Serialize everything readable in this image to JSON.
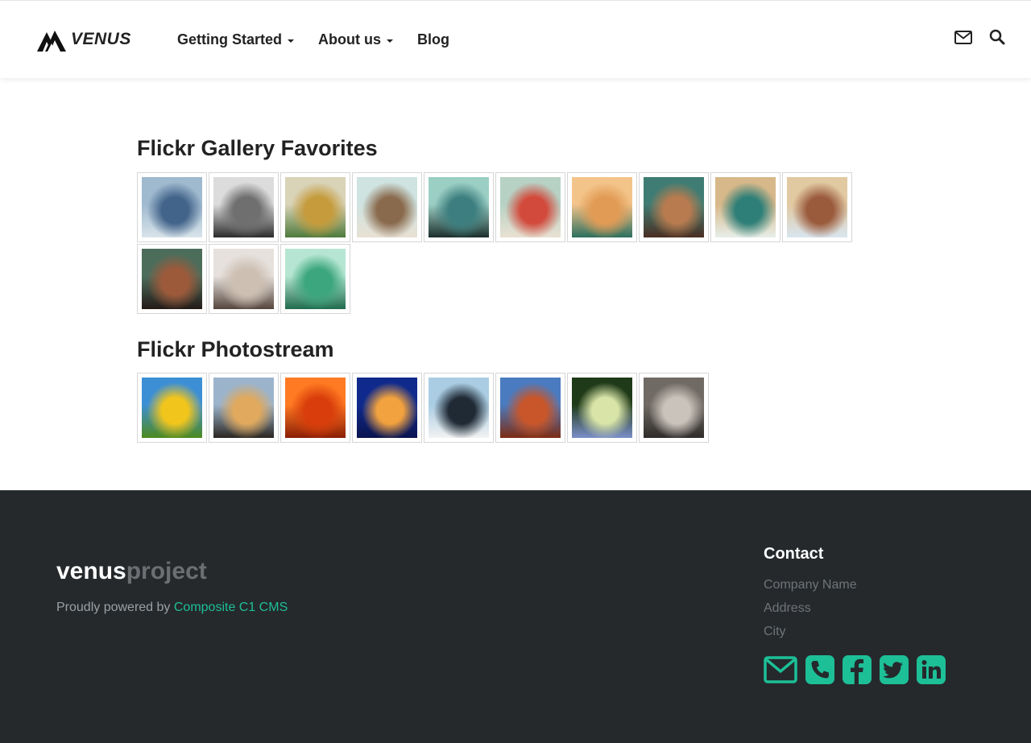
{
  "header": {
    "logo_text": "VENUS",
    "nav": [
      {
        "label": "Getting Started",
        "dropdown": true
      },
      {
        "label": "About us",
        "dropdown": true
      },
      {
        "label": "Blog",
        "dropdown": false
      }
    ],
    "icons": [
      "envelope-icon",
      "search-icon"
    ]
  },
  "main": {
    "favorites_title": "Flickr Gallery Favorites",
    "photostream_title": "Flickr Photostream",
    "favorites": [
      {
        "name": "sky-sea",
        "colors": [
          "#9fb9cf",
          "#43648a",
          "#d9e4ea"
        ]
      },
      {
        "name": "vw-van",
        "colors": [
          "#dcdcdc",
          "#6f6f6f",
          "#2b2b2b"
        ]
      },
      {
        "name": "paintings-wall",
        "colors": [
          "#d9d3b8",
          "#c59b3b",
          "#4e7a3b"
        ]
      },
      {
        "name": "chair-beach",
        "colors": [
          "#cfe3e0",
          "#8a6a4d",
          "#e8e1d4"
        ]
      },
      {
        "name": "umbrella-bench",
        "colors": [
          "#9ccfc4",
          "#3d7f80",
          "#1c2f2c"
        ]
      },
      {
        "name": "red-alarm-clock",
        "colors": [
          "#b7d2c5",
          "#d24a3c",
          "#e9e1d2"
        ]
      },
      {
        "name": "green-pitcher",
        "colors": [
          "#f3c48a",
          "#e29b55",
          "#2c6f5e"
        ]
      },
      {
        "name": "dog-portrait",
        "colors": [
          "#3f7c73",
          "#b87b4f",
          "#4a2e22"
        ]
      },
      {
        "name": "ocean-waves",
        "colors": [
          "#d7b88a",
          "#2e7f78",
          "#e7efe9"
        ]
      },
      {
        "name": "beach-building",
        "colors": [
          "#e1c9a1",
          "#9a5a3c",
          "#d8e5ef"
        ]
      },
      {
        "name": "street-musicians",
        "colors": [
          "#4d6d5b",
          "#9c5a3b",
          "#241a16"
        ]
      },
      {
        "name": "woman-beach",
        "colors": [
          "#e6e1dd",
          "#cdbfb2",
          "#55453c"
        ]
      },
      {
        "name": "palm-frond",
        "colors": [
          "#b6e6d3",
          "#3ca67e",
          "#1f6b4d"
        ]
      }
    ],
    "photostream": [
      {
        "name": "yellow-tulips",
        "colors": [
          "#3c8fd4",
          "#f1c51c",
          "#4e8a1e"
        ]
      },
      {
        "name": "lighthouse-sunset",
        "colors": [
          "#9bb4cc",
          "#e0a95e",
          "#2b2622"
        ]
      },
      {
        "name": "orange-chrysanthemum",
        "colors": [
          "#ff7a22",
          "#d83d0b",
          "#8a1e05"
        ]
      },
      {
        "name": "jellyfish",
        "colors": [
          "#0f2a8c",
          "#f2a23e",
          "#0a1450"
        ]
      },
      {
        "name": "penguins",
        "colors": [
          "#aacde3",
          "#1f2a35",
          "#f2f2f2"
        ]
      },
      {
        "name": "desert-mesa",
        "colors": [
          "#4a7bc0",
          "#c8562a",
          "#7d2b12"
        ]
      },
      {
        "name": "hydrangea",
        "colors": [
          "#1f3a18",
          "#d8e4a8",
          "#7b8fc9"
        ]
      },
      {
        "name": "koala",
        "colors": [
          "#6f6a63",
          "#c9c3bb",
          "#2f2c29"
        ]
      }
    ]
  },
  "footer": {
    "brand_part1": "venus",
    "brand_part2": "project",
    "powered_prefix": "Proudly powered by ",
    "powered_link": "Composite C1 CMS",
    "contact_title": "Contact",
    "contact_lines": [
      "Company Name",
      "Address",
      "City"
    ],
    "social": [
      "envelope-icon",
      "phone-icon",
      "facebook-icon",
      "twitter-icon",
      "linkedin-icon"
    ],
    "accent": "#1dbf97"
  }
}
